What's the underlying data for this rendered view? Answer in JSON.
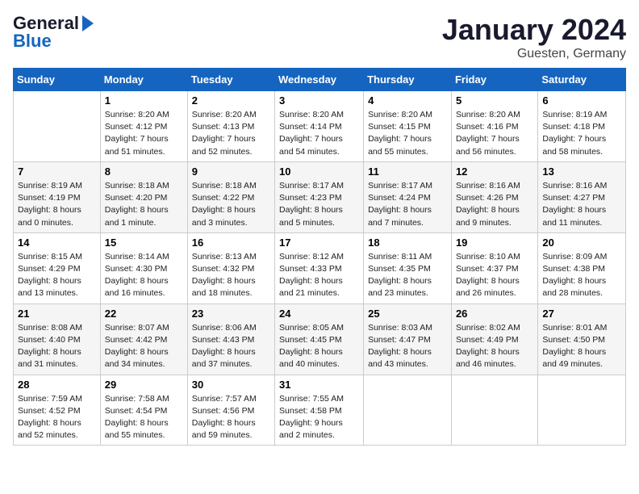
{
  "header": {
    "month_title": "January 2024",
    "location": "Guesten, Germany",
    "logo_line1": "General",
    "logo_line2": "Blue"
  },
  "weekdays": [
    "Sunday",
    "Monday",
    "Tuesday",
    "Wednesday",
    "Thursday",
    "Friday",
    "Saturday"
  ],
  "weeks": [
    [
      {
        "day": "",
        "sunrise": "",
        "sunset": "",
        "daylight": ""
      },
      {
        "day": "1",
        "sunrise": "Sunrise: 8:20 AM",
        "sunset": "Sunset: 4:12 PM",
        "daylight": "Daylight: 7 hours and 51 minutes."
      },
      {
        "day": "2",
        "sunrise": "Sunrise: 8:20 AM",
        "sunset": "Sunset: 4:13 PM",
        "daylight": "Daylight: 7 hours and 52 minutes."
      },
      {
        "day": "3",
        "sunrise": "Sunrise: 8:20 AM",
        "sunset": "Sunset: 4:14 PM",
        "daylight": "Daylight: 7 hours and 54 minutes."
      },
      {
        "day": "4",
        "sunrise": "Sunrise: 8:20 AM",
        "sunset": "Sunset: 4:15 PM",
        "daylight": "Daylight: 7 hours and 55 minutes."
      },
      {
        "day": "5",
        "sunrise": "Sunrise: 8:20 AM",
        "sunset": "Sunset: 4:16 PM",
        "daylight": "Daylight: 7 hours and 56 minutes."
      },
      {
        "day": "6",
        "sunrise": "Sunrise: 8:19 AM",
        "sunset": "Sunset: 4:18 PM",
        "daylight": "Daylight: 7 hours and 58 minutes."
      }
    ],
    [
      {
        "day": "7",
        "sunrise": "Sunrise: 8:19 AM",
        "sunset": "Sunset: 4:19 PM",
        "daylight": "Daylight: 8 hours and 0 minutes."
      },
      {
        "day": "8",
        "sunrise": "Sunrise: 8:18 AM",
        "sunset": "Sunset: 4:20 PM",
        "daylight": "Daylight: 8 hours and 1 minute."
      },
      {
        "day": "9",
        "sunrise": "Sunrise: 8:18 AM",
        "sunset": "Sunset: 4:22 PM",
        "daylight": "Daylight: 8 hours and 3 minutes."
      },
      {
        "day": "10",
        "sunrise": "Sunrise: 8:17 AM",
        "sunset": "Sunset: 4:23 PM",
        "daylight": "Daylight: 8 hours and 5 minutes."
      },
      {
        "day": "11",
        "sunrise": "Sunrise: 8:17 AM",
        "sunset": "Sunset: 4:24 PM",
        "daylight": "Daylight: 8 hours and 7 minutes."
      },
      {
        "day": "12",
        "sunrise": "Sunrise: 8:16 AM",
        "sunset": "Sunset: 4:26 PM",
        "daylight": "Daylight: 8 hours and 9 minutes."
      },
      {
        "day": "13",
        "sunrise": "Sunrise: 8:16 AM",
        "sunset": "Sunset: 4:27 PM",
        "daylight": "Daylight: 8 hours and 11 minutes."
      }
    ],
    [
      {
        "day": "14",
        "sunrise": "Sunrise: 8:15 AM",
        "sunset": "Sunset: 4:29 PM",
        "daylight": "Daylight: 8 hours and 13 minutes."
      },
      {
        "day": "15",
        "sunrise": "Sunrise: 8:14 AM",
        "sunset": "Sunset: 4:30 PM",
        "daylight": "Daylight: 8 hours and 16 minutes."
      },
      {
        "day": "16",
        "sunrise": "Sunrise: 8:13 AM",
        "sunset": "Sunset: 4:32 PM",
        "daylight": "Daylight: 8 hours and 18 minutes."
      },
      {
        "day": "17",
        "sunrise": "Sunrise: 8:12 AM",
        "sunset": "Sunset: 4:33 PM",
        "daylight": "Daylight: 8 hours and 21 minutes."
      },
      {
        "day": "18",
        "sunrise": "Sunrise: 8:11 AM",
        "sunset": "Sunset: 4:35 PM",
        "daylight": "Daylight: 8 hours and 23 minutes."
      },
      {
        "day": "19",
        "sunrise": "Sunrise: 8:10 AM",
        "sunset": "Sunset: 4:37 PM",
        "daylight": "Daylight: 8 hours and 26 minutes."
      },
      {
        "day": "20",
        "sunrise": "Sunrise: 8:09 AM",
        "sunset": "Sunset: 4:38 PM",
        "daylight": "Daylight: 8 hours and 28 minutes."
      }
    ],
    [
      {
        "day": "21",
        "sunrise": "Sunrise: 8:08 AM",
        "sunset": "Sunset: 4:40 PM",
        "daylight": "Daylight: 8 hours and 31 minutes."
      },
      {
        "day": "22",
        "sunrise": "Sunrise: 8:07 AM",
        "sunset": "Sunset: 4:42 PM",
        "daylight": "Daylight: 8 hours and 34 minutes."
      },
      {
        "day": "23",
        "sunrise": "Sunrise: 8:06 AM",
        "sunset": "Sunset: 4:43 PM",
        "daylight": "Daylight: 8 hours and 37 minutes."
      },
      {
        "day": "24",
        "sunrise": "Sunrise: 8:05 AM",
        "sunset": "Sunset: 4:45 PM",
        "daylight": "Daylight: 8 hours and 40 minutes."
      },
      {
        "day": "25",
        "sunrise": "Sunrise: 8:03 AM",
        "sunset": "Sunset: 4:47 PM",
        "daylight": "Daylight: 8 hours and 43 minutes."
      },
      {
        "day": "26",
        "sunrise": "Sunrise: 8:02 AM",
        "sunset": "Sunset: 4:49 PM",
        "daylight": "Daylight: 8 hours and 46 minutes."
      },
      {
        "day": "27",
        "sunrise": "Sunrise: 8:01 AM",
        "sunset": "Sunset: 4:50 PM",
        "daylight": "Daylight: 8 hours and 49 minutes."
      }
    ],
    [
      {
        "day": "28",
        "sunrise": "Sunrise: 7:59 AM",
        "sunset": "Sunset: 4:52 PM",
        "daylight": "Daylight: 8 hours and 52 minutes."
      },
      {
        "day": "29",
        "sunrise": "Sunrise: 7:58 AM",
        "sunset": "Sunset: 4:54 PM",
        "daylight": "Daylight: 8 hours and 55 minutes."
      },
      {
        "day": "30",
        "sunrise": "Sunrise: 7:57 AM",
        "sunset": "Sunset: 4:56 PM",
        "daylight": "Daylight: 8 hours and 59 minutes."
      },
      {
        "day": "31",
        "sunrise": "Sunrise: 7:55 AM",
        "sunset": "Sunset: 4:58 PM",
        "daylight": "Daylight: 9 hours and 2 minutes."
      },
      {
        "day": "",
        "sunrise": "",
        "sunset": "",
        "daylight": ""
      },
      {
        "day": "",
        "sunrise": "",
        "sunset": "",
        "daylight": ""
      },
      {
        "day": "",
        "sunrise": "",
        "sunset": "",
        "daylight": ""
      }
    ]
  ]
}
